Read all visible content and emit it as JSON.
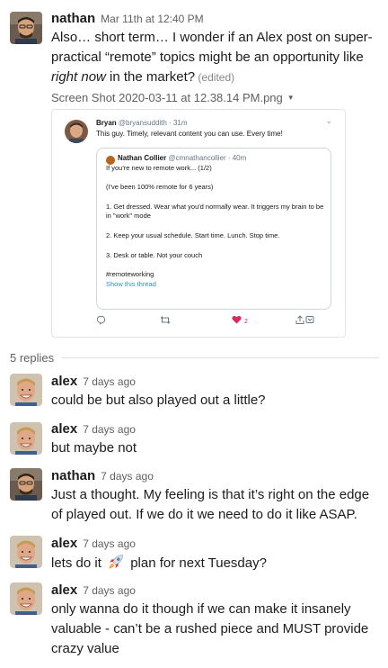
{
  "parent": {
    "author": "nathan",
    "timestamp": "Mar 11th at 12:40 PM",
    "text_line1": "Also… short term… I wonder if an Alex post on super-",
    "text_line2": "practical “remote” topics might be an opportunity like",
    "text_line3_italic": "right now",
    "text_line3_rest": " in the market?",
    "edited": " (edited)",
    "file_name": "Screen Shot 2020-03-11 at 12.38.14 PM.png",
    "file_caret": "▼"
  },
  "tweet": {
    "name": "Bryan",
    "handle": "@bryansuddith · 31m",
    "chevron": "⌄",
    "text": "This guy. Timely, relevant content you can use. Every time!",
    "quoted": {
      "name": "Nathan Collier",
      "handle": "@cmnathancollier · 40m",
      "lines": [
        "If you're new to remote work... (1/2)",
        "(I've been 100% remote for 6 years)",
        "1. Get dressed. Wear what you'd normally wear. It triggers my brain to be",
        "in \"work\" mode",
        "2. Keep your usual schedule. Start time. Lunch. Stop time.",
        "3. Desk or table. Not your couch",
        "#remoteworking"
      ],
      "show_thread": "Show this thread"
    },
    "actions": {
      "reply_icon": "reply-icon",
      "retweet_icon": "retweet-icon",
      "like_icon": "heart-icon",
      "like_count": "2",
      "share_icon": "share-icon"
    }
  },
  "replies_label": "5 replies",
  "replies": [
    {
      "author": "alex",
      "timestamp": "7 days ago",
      "lines": [
        "could be but also played out a little?"
      ]
    },
    {
      "author": "alex",
      "timestamp": "7 days ago",
      "lines": [
        "but maybe not"
      ]
    },
    {
      "author": "nathan",
      "timestamp": "7 days ago",
      "lines": [
        "Just a thought. My feeling is that it’s right on the edge",
        "of played out. If we do it we need to do it like ASAP."
      ]
    },
    {
      "author": "alex",
      "timestamp": "7 days ago",
      "text_before": "lets do it ",
      "emoji": "rocket",
      "text_after": " plan for next Tuesday?"
    },
    {
      "author": "alex",
      "timestamp": "7 days ago",
      "lines": [
        "only wanna do it though if we can make it insanely",
        "valuable - can’t be a rushed piece and MUST provide",
        "crazy value"
      ]
    }
  ],
  "colors": {
    "text": "#1d1c1d",
    "muted": "#616061",
    "twitter_blue": "#1b95e0",
    "like_red": "#e0245e"
  }
}
